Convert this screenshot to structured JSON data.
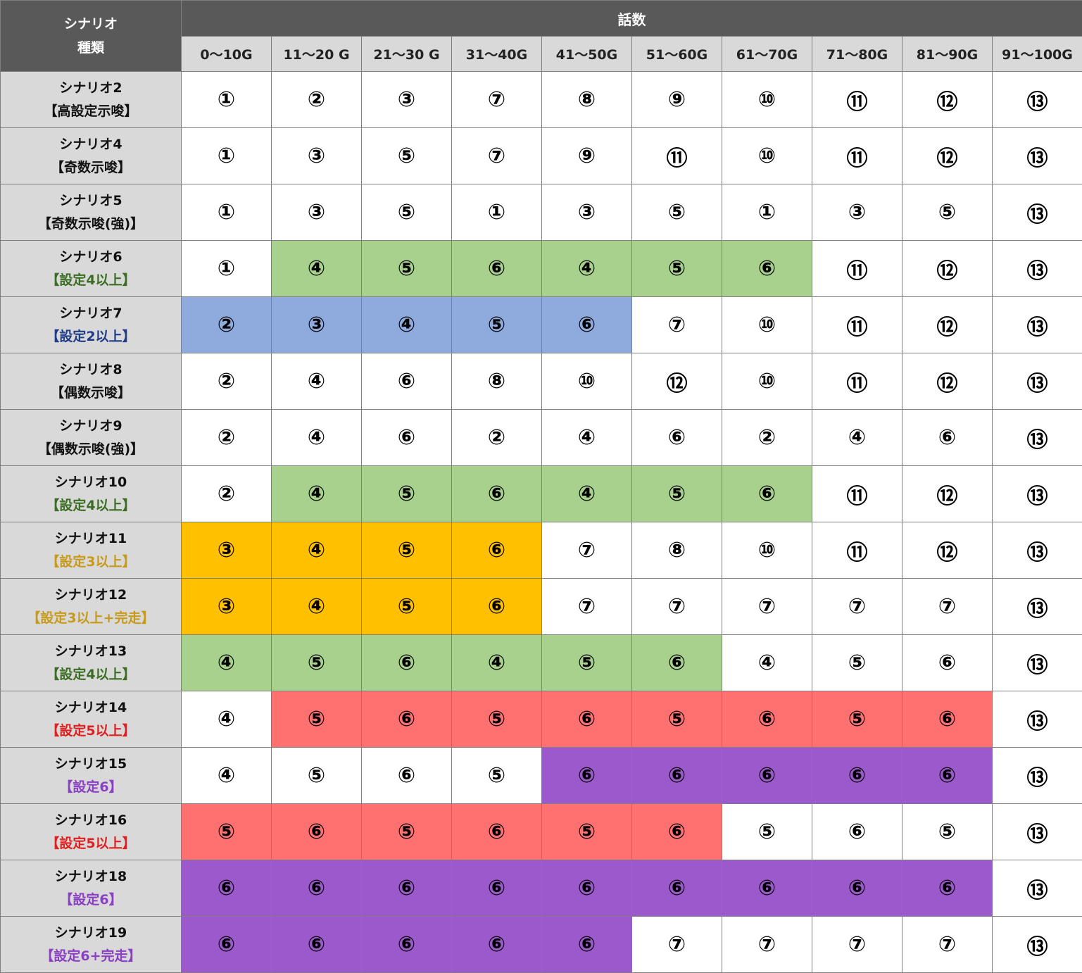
{
  "header": {
    "corner_line1": "シナリオ",
    "corner_line2": "種類",
    "episodes_label": "話数",
    "ranges": [
      "0～10G",
      "11～20 G",
      "21～30 G",
      "31～40G",
      "41～50G",
      "51～60G",
      "61～70G",
      "71～80G",
      "81～90G",
      "91～100G"
    ]
  },
  "colors": {
    "header_dark": "#595959",
    "header_light": "#d9d9d9",
    "green": "#a9d18e",
    "blue": "#8faadc",
    "orange": "#ffc000",
    "red": "#ff7171",
    "purple": "#9b59cc",
    "white": "#ffffff"
  },
  "rows": [
    {
      "name": "シナリオ2",
      "tag": "【高設定示唆】",
      "tag_color": "#111111",
      "cells": [
        "①",
        "②",
        "③",
        "⑦",
        "⑧",
        "⑨",
        "⑩",
        "⑪",
        "⑫",
        "⑬"
      ],
      "fills": [
        "white",
        "white",
        "white",
        "white",
        "white",
        "white",
        "white",
        "white",
        "white",
        "white"
      ]
    },
    {
      "name": "シナリオ4",
      "tag": "【奇数示唆】",
      "tag_color": "#111111",
      "cells": [
        "①",
        "③",
        "⑤",
        "⑦",
        "⑨",
        "⑪",
        "⑩",
        "⑪",
        "⑫",
        "⑬"
      ],
      "fills": [
        "white",
        "white",
        "white",
        "white",
        "white",
        "white",
        "white",
        "white",
        "white",
        "white"
      ]
    },
    {
      "name": "シナリオ5",
      "tag": "【奇数示唆(強)】",
      "tag_color": "#111111",
      "cells": [
        "①",
        "③",
        "⑤",
        "①",
        "③",
        "⑤",
        "①",
        "③",
        "⑤",
        "⑬"
      ],
      "fills": [
        "white",
        "white",
        "white",
        "white",
        "white",
        "white",
        "white",
        "white",
        "white",
        "white"
      ]
    },
    {
      "name": "シナリオ6",
      "tag": "【設定4以上】",
      "tag_color": "#3b6e22",
      "cells": [
        "①",
        "④",
        "⑤",
        "⑥",
        "④",
        "⑤",
        "⑥",
        "⑪",
        "⑫",
        "⑬"
      ],
      "fills": [
        "white",
        "green",
        "green",
        "green",
        "green",
        "green",
        "green",
        "white",
        "white",
        "white"
      ]
    },
    {
      "name": "シナリオ7",
      "tag": "【設定2以上】",
      "tag_color": "#1f3c88",
      "cells": [
        "②",
        "③",
        "④",
        "⑤",
        "⑥",
        "⑦",
        "⑩",
        "⑪",
        "⑫",
        "⑬"
      ],
      "fills": [
        "blue",
        "blue",
        "blue",
        "blue",
        "blue",
        "white",
        "white",
        "white",
        "white",
        "white"
      ]
    },
    {
      "name": "シナリオ8",
      "tag": "【偶数示唆】",
      "tag_color": "#111111",
      "cells": [
        "②",
        "④",
        "⑥",
        "⑧",
        "⑩",
        "⑫",
        "⑩",
        "⑪",
        "⑫",
        "⑬"
      ],
      "fills": [
        "white",
        "white",
        "white",
        "white",
        "white",
        "white",
        "white",
        "white",
        "white",
        "white"
      ]
    },
    {
      "name": "シナリオ9",
      "tag": "【偶数示唆(強)】",
      "tag_color": "#111111",
      "cells": [
        "②",
        "④",
        "⑥",
        "②",
        "④",
        "⑥",
        "②",
        "④",
        "⑥",
        "⑬"
      ],
      "fills": [
        "white",
        "white",
        "white",
        "white",
        "white",
        "white",
        "white",
        "white",
        "white",
        "white"
      ]
    },
    {
      "name": "シナリオ10",
      "tag": "【設定4以上】",
      "tag_color": "#3b6e22",
      "cells": [
        "②",
        "④",
        "⑤",
        "⑥",
        "④",
        "⑤",
        "⑥",
        "⑪",
        "⑫",
        "⑬"
      ],
      "fills": [
        "white",
        "green",
        "green",
        "green",
        "green",
        "green",
        "green",
        "white",
        "white",
        "white"
      ]
    },
    {
      "name": "シナリオ11",
      "tag": "【設定3以上】",
      "tag_color": "#c89a1a",
      "cells": [
        "③",
        "④",
        "⑤",
        "⑥",
        "⑦",
        "⑧",
        "⑩",
        "⑪",
        "⑫",
        "⑬"
      ],
      "fills": [
        "orange",
        "orange",
        "orange",
        "orange",
        "white",
        "white",
        "white",
        "white",
        "white",
        "white"
      ]
    },
    {
      "name": "シナリオ12",
      "tag": "【設定3以上+完走】",
      "tag_color": "#c89a1a",
      "cells": [
        "③",
        "④",
        "⑤",
        "⑥",
        "⑦",
        "⑦",
        "⑦",
        "⑦",
        "⑦",
        "⑬"
      ],
      "fills": [
        "orange",
        "orange",
        "orange",
        "orange",
        "white",
        "white",
        "white",
        "white",
        "white",
        "white"
      ]
    },
    {
      "name": "シナリオ13",
      "tag": "【設定4以上】",
      "tag_color": "#3b6e22",
      "cells": [
        "④",
        "⑤",
        "⑥",
        "④",
        "⑤",
        "⑥",
        "④",
        "⑤",
        "⑥",
        "⑬"
      ],
      "fills": [
        "green",
        "green",
        "green",
        "green",
        "green",
        "green",
        "white",
        "white",
        "white",
        "white"
      ]
    },
    {
      "name": "シナリオ14",
      "tag": "【設定5以上】",
      "tag_color": "#e02020",
      "cells": [
        "④",
        "⑤",
        "⑥",
        "⑤",
        "⑥",
        "⑤",
        "⑥",
        "⑤",
        "⑥",
        "⑬"
      ],
      "fills": [
        "white",
        "red",
        "red",
        "red",
        "red",
        "red",
        "red",
        "red",
        "red",
        "white"
      ]
    },
    {
      "name": "シナリオ15",
      "tag": "【設定6】",
      "tag_color": "#8a3fc4",
      "cells": [
        "④",
        "⑤",
        "⑥",
        "⑤",
        "⑥",
        "⑥",
        "⑥",
        "⑥",
        "⑥",
        "⑬"
      ],
      "fills": [
        "white",
        "white",
        "white",
        "white",
        "purple",
        "purple",
        "purple",
        "purple",
        "purple",
        "white"
      ]
    },
    {
      "name": "シナリオ16",
      "tag": "【設定5以上】",
      "tag_color": "#e02020",
      "cells": [
        "⑤",
        "⑥",
        "⑤",
        "⑥",
        "⑤",
        "⑥",
        "⑤",
        "⑥",
        "⑤",
        "⑬"
      ],
      "fills": [
        "red",
        "red",
        "red",
        "red",
        "red",
        "red",
        "white",
        "white",
        "white",
        "white"
      ]
    },
    {
      "name": "シナリオ18",
      "tag": "【設定6】",
      "tag_color": "#8a3fc4",
      "cells": [
        "⑥",
        "⑥",
        "⑥",
        "⑥",
        "⑥",
        "⑥",
        "⑥",
        "⑥",
        "⑥",
        "⑬"
      ],
      "fills": [
        "purple",
        "purple",
        "purple",
        "purple",
        "purple",
        "purple",
        "purple",
        "purple",
        "purple",
        "white"
      ]
    },
    {
      "name": "シナリオ19",
      "tag": "【設定6+完走】",
      "tag_color": "#8a3fc4",
      "cells": [
        "⑥",
        "⑥",
        "⑥",
        "⑥",
        "⑥",
        "⑦",
        "⑦",
        "⑦",
        "⑦",
        "⑬"
      ],
      "fills": [
        "purple",
        "purple",
        "purple",
        "purple",
        "purple",
        "white",
        "white",
        "white",
        "white",
        "white"
      ]
    }
  ]
}
